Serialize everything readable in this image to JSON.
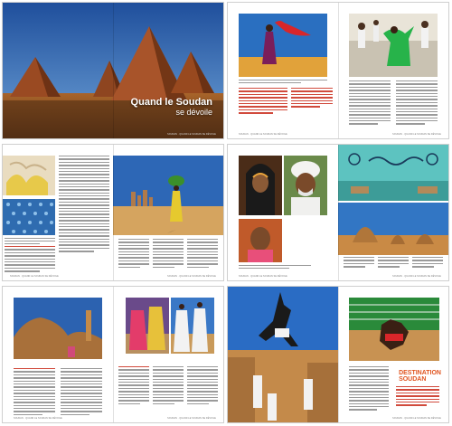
{
  "spread1": {
    "cover_title_line1": "Quand le Soudan",
    "cover_title_line2": "se dévoile",
    "folio_right": "SOUDAN · QUAND LE SOUDAN SE DÉVOILE"
  },
  "spread2": {
    "folio_left": "SOUDAN · QUAND LE SOUDAN SE DÉVOILE",
    "folio_right": "SOUDAN · QUAND LE SOUDAN SE DÉVOILE"
  },
  "spread3": {
    "folio_left": "SOUDAN · QUAND LE SOUDAN SE DÉVOILE",
    "folio_right": "SOUDAN · QUAND LE SOUDAN SE DÉVOILE"
  },
  "spread4": {
    "folio_left": "SOUDAN · QUAND LE SOUDAN SE DÉVOILE",
    "folio_right": "SOUDAN · QUAND LE SOUDAN SE DÉVOILE"
  },
  "spread5": {
    "folio_left": "SOUDAN · QUAND LE SOUDAN SE DÉVOILE",
    "folio_right": "SOUDAN · QUAND LE SOUDAN SE DÉVOILE"
  },
  "spread6": {
    "dest_line1": "DESTINATION",
    "dest_line2": "SOUDAN",
    "folio_right": "SOUDAN · QUAND LE SOUDAN SE DÉVOILE"
  },
  "colors": {
    "accent_red": "#c0392b",
    "accent_orange": "#e0541f",
    "sky_blue": "#2b6fb8",
    "sand": "#d8a45a"
  }
}
